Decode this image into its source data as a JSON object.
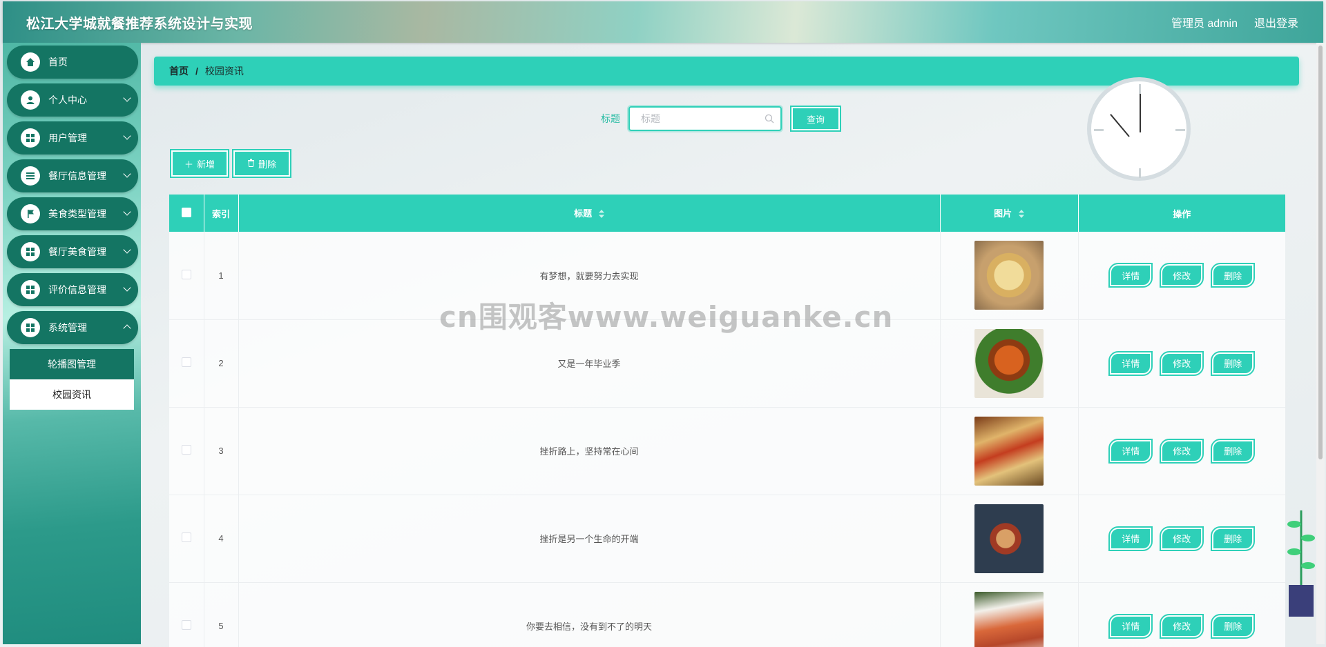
{
  "header": {
    "title": "松江大学城就餐推荐系统设计与实现",
    "user_label": "管理员 admin",
    "logout_label": "退出登录"
  },
  "sidebar": {
    "items": [
      {
        "label": "首页",
        "icon": "home-icon",
        "expandable": false
      },
      {
        "label": "个人中心",
        "icon": "user-icon",
        "expandable": true
      },
      {
        "label": "用户管理",
        "icon": "grid-icon",
        "expandable": true
      },
      {
        "label": "餐厅信息管理",
        "icon": "list-icon",
        "expandable": true
      },
      {
        "label": "美食类型管理",
        "icon": "flag-icon",
        "expandable": true
      },
      {
        "label": "餐厅美食管理",
        "icon": "grid-icon",
        "expandable": true
      },
      {
        "label": "评价信息管理",
        "icon": "grid-icon",
        "expandable": true
      },
      {
        "label": "系统管理",
        "icon": "grid-icon",
        "expandable": true
      }
    ],
    "submenu": [
      {
        "label": "轮播图管理"
      },
      {
        "label": "校园资讯"
      }
    ]
  },
  "breadcrumb": {
    "home": "首页",
    "separator": "/",
    "current": "校园资讯"
  },
  "search": {
    "label": "标题",
    "placeholder": "标题",
    "button": "查询"
  },
  "toolbar": {
    "add_label": "新增",
    "delete_label": "删除"
  },
  "table": {
    "headers": {
      "index": "索引",
      "title": "标题",
      "image": "图片",
      "actions": "操作"
    },
    "action_labels": {
      "detail": "详情",
      "edit": "修改",
      "delete": "删除"
    },
    "rows": [
      {
        "index": "1",
        "title": "有梦想，就要努力去实现",
        "image": "food-platter-image"
      },
      {
        "index": "2",
        "title": "又是一年毕业季",
        "image": "crab-dish-image"
      },
      {
        "index": "3",
        "title": "挫折路上，坚持常在心间",
        "image": "tacos-image"
      },
      {
        "index": "4",
        "title": "挫折是另一个生命的开端",
        "image": "dinner-table-image"
      },
      {
        "index": "5",
        "title": "你要去相信，没有到不了的明天",
        "image": "salmon-dish-image"
      }
    ]
  },
  "watermark": "cn围观客www.weiguanke.cn",
  "colors": {
    "accent": "#2ed0b8",
    "sidebar_item": "#147563"
  }
}
